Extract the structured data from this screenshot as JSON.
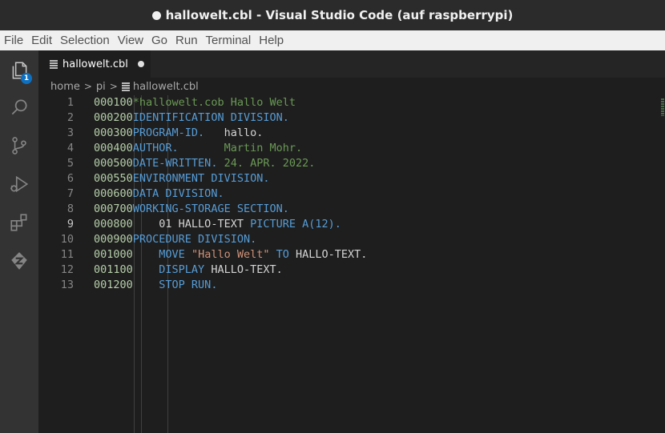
{
  "window": {
    "title": "hallowelt.cbl - Visual Studio Code (auf raspberrypi)"
  },
  "menu": [
    "File",
    "Edit",
    "Selection",
    "View",
    "Go",
    "Run",
    "Terminal",
    "Help"
  ],
  "activity": {
    "explorer_badge": "1",
    "icons": [
      "explorer-icon",
      "search-icon",
      "source-control-icon",
      "run-debug-icon",
      "extensions-icon",
      "remote-explorer-icon"
    ]
  },
  "tab": {
    "label": "hallowelt.cbl",
    "modified": true
  },
  "breadcrumb": [
    "home",
    "pi",
    "hallowelt.cbl"
  ],
  "editor": {
    "active_line": 9,
    "line_numbers": [
      "1",
      "2",
      "3",
      "4",
      "5",
      "6",
      "7",
      "8",
      "9",
      "10",
      "11",
      "12",
      "13"
    ],
    "lines": [
      [
        {
          "t": "000100",
          "c": "seq"
        },
        {
          "t": "*hallowelt.cob Hallo Welt",
          "c": "cmt"
        }
      ],
      [
        {
          "t": "000200",
          "c": "seq"
        },
        {
          "t": "IDENTIFICATION DIVISION.",
          "c": "kw"
        }
      ],
      [
        {
          "t": "000300",
          "c": "seq"
        },
        {
          "t": "PROGRAM-ID.",
          "c": "kw"
        },
        {
          "t": "   hallo.",
          "c": "plain"
        }
      ],
      [
        {
          "t": "000400",
          "c": "seq"
        },
        {
          "t": "AUTHOR.",
          "c": "kw"
        },
        {
          "t": "       Martin Mohr.",
          "c": "cmt"
        }
      ],
      [
        {
          "t": "000500",
          "c": "seq"
        },
        {
          "t": "DATE-WRITTEN.",
          "c": "kw"
        },
        {
          "t": " 24. APR. 2022.",
          "c": "cmt"
        }
      ],
      [
        {
          "t": "000550",
          "c": "seq"
        },
        {
          "t": "ENVIRONMENT DIVISION.",
          "c": "kw"
        }
      ],
      [
        {
          "t": "000600",
          "c": "seq"
        },
        {
          "t": "DATA DIVISION.",
          "c": "kw"
        }
      ],
      [
        {
          "t": "000700",
          "c": "seq"
        },
        {
          "t": "WORKING-STORAGE SECTION.",
          "c": "kw"
        }
      ],
      [
        {
          "t": "000800",
          "c": "seq"
        },
        {
          "t": "    01 HALLO-TEXT ",
          "c": "plain"
        },
        {
          "t": "PICTURE A(12).",
          "c": "kw"
        }
      ],
      [
        {
          "t": "000900",
          "c": "seq"
        },
        {
          "t": "PROCEDURE DIVISION.",
          "c": "kw"
        }
      ],
      [
        {
          "t": "001000",
          "c": "seq"
        },
        {
          "t": "    MOVE ",
          "c": "kw"
        },
        {
          "t": "\"Hallo Welt\"",
          "c": "str"
        },
        {
          "t": " TO ",
          "c": "kw"
        },
        {
          "t": "HALLO-TEXT.",
          "c": "plain"
        }
      ],
      [
        {
          "t": "001100",
          "c": "seq"
        },
        {
          "t": "    DISPLAY ",
          "c": "kw"
        },
        {
          "t": "HALLO-TEXT.",
          "c": "plain"
        }
      ],
      [
        {
          "t": "001200",
          "c": "seq"
        },
        {
          "t": "    STOP RUN.",
          "c": "kw"
        }
      ]
    ]
  }
}
